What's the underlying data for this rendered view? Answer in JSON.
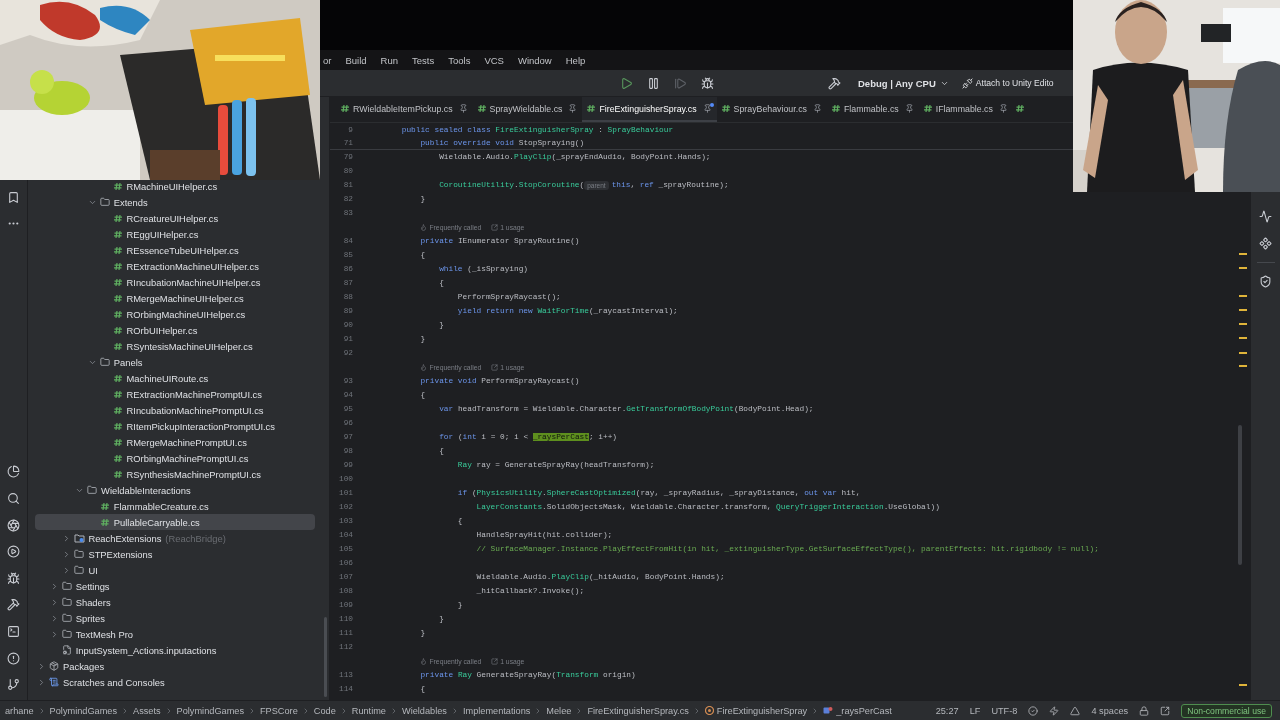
{
  "menu": [
    "or",
    "Build",
    "Run",
    "Tests",
    "Tools",
    "VCS",
    "Window",
    "Help"
  ],
  "toolbar": {
    "actions": [
      {
        "kind": "run",
        "disabled": false
      },
      {
        "kind": "pause",
        "disabled": false
      },
      {
        "kind": "step",
        "disabled": true
      },
      {
        "kind": "debug",
        "disabled": false
      }
    ],
    "configuration": "Debug | Any CPU",
    "attach": "Attach to Unity Edito"
  },
  "project_tree": [
    {
      "children": [
        {
          "children": [
            {
              "children": [
                {
                  "children": [
                    {
                      "children": [
                        {
                          "label": "RMachineUIHelper.cs",
                          "kind": "file",
                          "selected": false
                        }
                      ]
                    },
                    {
                      "label": "Extends",
                      "kind": "folder",
                      "expanded": true,
                      "selected": false,
                      "children": [
                        {
                          "label": "RCreatureUIHelper.cs",
                          "kind": "file",
                          "selected": false
                        },
                        {
                          "label": "REggUIHelper.cs",
                          "kind": "file",
                          "selected": false
                        },
                        {
                          "label": "REssenceTubeUIHelper.cs",
                          "kind": "file",
                          "selected": false
                        },
                        {
                          "label": "RExtractionMachineUIHelper.cs",
                          "kind": "file",
                          "selected": false
                        },
                        {
                          "label": "RIncubationMachineUIHelper.cs",
                          "kind": "file",
                          "selected": false
                        },
                        {
                          "label": "RMergeMachineUIHelper.cs",
                          "kind": "file",
                          "selected": false
                        },
                        {
                          "label": "ROrbingMachineUIHelper.cs",
                          "kind": "file",
                          "selected": false
                        },
                        {
                          "label": "ROrbUIHelper.cs",
                          "kind": "file",
                          "selected": false
                        },
                        {
                          "label": "RSyntesisMachineUIHelper.cs",
                          "kind": "file",
                          "selected": false
                        }
                      ]
                    },
                    {
                      "label": "Panels",
                      "kind": "folder",
                      "expanded": true,
                      "selected": false,
                      "children": [
                        {
                          "label": "MachineUIRoute.cs",
                          "kind": "file",
                          "selected": false
                        },
                        {
                          "label": "RExtractionMachinePromptUI.cs",
                          "kind": "file",
                          "selected": false
                        },
                        {
                          "label": "RIncubationMachinePromptUI.cs",
                          "kind": "file",
                          "selected": false
                        },
                        {
                          "label": "RItemPickupInteractionPromptUI.cs",
                          "kind": "file",
                          "selected": false
                        },
                        {
                          "label": "RMergeMachinePromptUI.cs",
                          "kind": "file",
                          "selected": false
                        },
                        {
                          "label": "ROrbingMachinePromptUI.cs",
                          "kind": "file",
                          "selected": false
                        },
                        {
                          "label": "RSynthesisMachinePromptUI.cs",
                          "kind": "file",
                          "selected": false
                        }
                      ]
                    }
                  ]
                },
                {
                  "label": "WieldableInteractions",
                  "kind": "folder",
                  "expanded": true,
                  "selected": false,
                  "children": [
                    {
                      "label": "FlammableCreature.cs",
                      "kind": "file",
                      "selected": false
                    },
                    {
                      "label": "PullableCarryable.cs",
                      "kind": "file",
                      "selected": true
                    }
                  ]
                }
              ]
            },
            {
              "label": "ReachExtensions",
              "note": "(ReachBridge)",
              "kind": "module",
              "expanded": false,
              "selected": false
            },
            {
              "label": "STPExtensions",
              "kind": "folder",
              "expanded": false,
              "selected": false
            },
            {
              "label": "UI",
              "kind": "folder",
              "expanded": false,
              "selected": false
            }
          ]
        },
        {
          "label": "Settings",
          "kind": "folder",
          "expanded": false,
          "selected": false
        },
        {
          "label": "Shaders",
          "kind": "folder",
          "expanded": false,
          "selected": false
        },
        {
          "label": "Sprites",
          "kind": "folder",
          "expanded": false,
          "selected": false
        },
        {
          "label": "TextMesh Pro",
          "kind": "folder",
          "expanded": false,
          "selected": false
        },
        {
          "label": "InputSystem_Actions.inputactions",
          "kind": "inputactions",
          "selected": false
        }
      ]
    },
    {
      "label": "Packages",
      "kind": "packages",
      "expanded": false,
      "selected": false
    },
    {
      "label": "Scratches and Consoles",
      "kind": "scratches",
      "expanded": false,
      "selected": false
    }
  ],
  "tabs": [
    {
      "label": "RWieldableItemPickup.cs",
      "selected": false,
      "modified": false
    },
    {
      "label": "SprayWieldable.cs",
      "selected": false,
      "modified": false
    },
    {
      "label": "FireExtinguisherSpray.cs",
      "selected": true,
      "modified": true
    },
    {
      "label": "SprayBehaviour.cs",
      "selected": false,
      "modified": false
    },
    {
      "label": "Flammable.cs",
      "selected": false,
      "modified": false
    },
    {
      "label": "IFlammable.cs",
      "selected": false,
      "modified": false
    }
  ],
  "sticky_lines": [
    {
      "number": "9",
      "tokens": [
        {
          "kind": "kw",
          "text": "    public sealed class "
        },
        {
          "kind": "type",
          "text": "FireExtinguisherSpray"
        },
        {
          "kind": "plain",
          "text": " : "
        },
        {
          "kind": "type",
          "text": "SprayBehaviour"
        }
      ]
    },
    {
      "number": "71",
      "tokens": [
        {
          "kind": "kw",
          "text": "        public override void "
        },
        {
          "kind": "plain",
          "text": "StopSpraying()"
        }
      ]
    }
  ],
  "code": [
    {
      "kind": "code",
      "number": "79",
      "tokens": [
        {
          "kind": "plain",
          "text": "            Wieldable.Audio."
        },
        {
          "kind": "type",
          "text": "PlayClip"
        },
        {
          "kind": "plain",
          "text": "(_sprayEndAudio, BodyPoint.Hands);"
        }
      ]
    },
    {
      "kind": "code",
      "number": "80"
    },
    {
      "kind": "code",
      "number": "81",
      "tokens": [
        {
          "kind": "type",
          "text": "            CoroutineUtility"
        },
        {
          "kind": "plain",
          "text": "."
        },
        {
          "kind": "type",
          "text": "StopCoroutine"
        },
        {
          "kind": "plain",
          "text": "("
        },
        {
          "kind": "hint",
          "text": "parent"
        },
        {
          "kind": "kw",
          "text": "this"
        },
        {
          "kind": "plain",
          "text": ", "
        },
        {
          "kind": "kw",
          "text": "ref"
        },
        {
          "kind": "plain",
          "text": " _sprayRoutine);"
        }
      ]
    },
    {
      "kind": "code",
      "number": "82",
      "tokens": [
        {
          "kind": "plain",
          "text": "        }"
        }
      ]
    },
    {
      "kind": "code",
      "number": "83"
    },
    {
      "kind": "hint",
      "hints": [
        "Frequently called",
        "1 usage"
      ]
    },
    {
      "kind": "code",
      "number": "84",
      "tokens": [
        {
          "kind": "kw",
          "text": "        private "
        },
        {
          "kind": "plain",
          "text": "IEnumerator SprayRoutine()"
        }
      ]
    },
    {
      "kind": "code",
      "number": "85",
      "tokens": [
        {
          "kind": "plain",
          "text": "        {"
        }
      ]
    },
    {
      "kind": "code",
      "number": "86",
      "tokens": [
        {
          "kind": "kw",
          "text": "            while"
        },
        {
          "kind": "plain",
          "text": " (_isSpraying)"
        }
      ]
    },
    {
      "kind": "code",
      "number": "87",
      "tokens": [
        {
          "kind": "plain",
          "text": "            {"
        }
      ]
    },
    {
      "kind": "code",
      "number": "88",
      "tokens": [
        {
          "kind": "plain",
          "text": "                PerformSprayRaycast();"
        }
      ]
    },
    {
      "kind": "code",
      "number": "89",
      "tokens": [
        {
          "kind": "kw",
          "text": "                yield return new "
        },
        {
          "kind": "type",
          "text": "WaitForTime"
        },
        {
          "kind": "plain",
          "text": "(_raycastInterval);"
        }
      ]
    },
    {
      "kind": "code",
      "number": "90",
      "tokens": [
        {
          "kind": "plain",
          "text": "            }"
        }
      ]
    },
    {
      "kind": "code",
      "number": "91",
      "tokens": [
        {
          "kind": "plain",
          "text": "        }"
        }
      ]
    },
    {
      "kind": "code",
      "number": "92"
    },
    {
      "kind": "hint",
      "hints": [
        "Frequently called",
        "1 usage"
      ]
    },
    {
      "kind": "code",
      "number": "93",
      "tokens": [
        {
          "kind": "kw",
          "text": "        private void "
        },
        {
          "kind": "plain",
          "text": "PerformSprayRaycast()"
        }
      ]
    },
    {
      "kind": "code",
      "number": "94",
      "tokens": [
        {
          "kind": "plain",
          "text": "        {"
        }
      ]
    },
    {
      "kind": "code",
      "number": "95",
      "tokens": [
        {
          "kind": "kw",
          "text": "            var "
        },
        {
          "kind": "plain",
          "text": "headTransform = Wieldable.Character."
        },
        {
          "kind": "type",
          "text": "GetTransformOfBodyPoint"
        },
        {
          "kind": "plain",
          "text": "(BodyPoint.Head);"
        }
      ]
    },
    {
      "kind": "code",
      "number": "96"
    },
    {
      "kind": "code",
      "number": "97",
      "tokens": [
        {
          "kind": "kw",
          "text": "            for "
        },
        {
          "kind": "plain",
          "text": "("
        },
        {
          "kind": "kw",
          "text": "int"
        },
        {
          "kind": "plain",
          "text": " i = 0; i < "
        },
        {
          "kind": "match",
          "text": "_raysPerCast"
        },
        {
          "kind": "plain",
          "text": "; i++)"
        }
      ]
    },
    {
      "kind": "code",
      "number": "98",
      "tokens": [
        {
          "kind": "plain",
          "text": "            {"
        }
      ]
    },
    {
      "kind": "code",
      "number": "99",
      "tokens": [
        {
          "kind": "type",
          "text": "                Ray"
        },
        {
          "kind": "plain",
          "text": " ray = GenerateSprayRay(headTransform);"
        }
      ]
    },
    {
      "kind": "code",
      "number": "100"
    },
    {
      "kind": "code",
      "number": "101",
      "tokens": [
        {
          "kind": "kw",
          "text": "                if"
        },
        {
          "kind": "plain",
          "text": " ("
        },
        {
          "kind": "type",
          "text": "PhysicsUtility"
        },
        {
          "kind": "plain",
          "text": "."
        },
        {
          "kind": "type",
          "text": "SphereCastOptimized"
        },
        {
          "kind": "plain",
          "text": "(ray, _sprayRadius, _sprayDistance, "
        },
        {
          "kind": "kw",
          "text": "out var"
        },
        {
          "kind": "plain",
          "text": " hit,"
        }
      ]
    },
    {
      "kind": "code",
      "number": "102",
      "tokens": [
        {
          "kind": "type",
          "text": "                    LayerConstants"
        },
        {
          "kind": "plain",
          "text": ".SolidObjectsMask, Wieldable.Character.transform, "
        },
        {
          "kind": "type",
          "text": "QueryTriggerInteraction"
        },
        {
          "kind": "plain",
          "text": ".UseGlobal))"
        }
      ]
    },
    {
      "kind": "code",
      "number": "103",
      "tokens": [
        {
          "kind": "plain",
          "text": "                {"
        }
      ]
    },
    {
      "kind": "code",
      "number": "104",
      "tokens": [
        {
          "kind": "plain",
          "text": "                    HandleSprayHit(hit.collider);"
        }
      ]
    },
    {
      "kind": "code",
      "number": "105",
      "tokens": [
        {
          "kind": "comment",
          "text": "                    // SurfaceManager.Instance.PlayEffectFromHit(in hit, _extinguisherType.GetSurfaceEffectType(), parentEffects: hit.rigidbody != null);"
        }
      ]
    },
    {
      "kind": "code",
      "number": "106"
    },
    {
      "kind": "code",
      "number": "107",
      "tokens": [
        {
          "kind": "plain",
          "text": "                    Wieldable.Audio."
        },
        {
          "kind": "type",
          "text": "PlayClip"
        },
        {
          "kind": "plain",
          "text": "(_hitAudio, BodyPoint.Hands);"
        }
      ]
    },
    {
      "kind": "code",
      "number": "108",
      "tokens": [
        {
          "kind": "plain",
          "text": "                    _hitCallback?.Invoke();"
        }
      ]
    },
    {
      "kind": "code",
      "number": "109",
      "tokens": [
        {
          "kind": "plain",
          "text": "                }"
        }
      ]
    },
    {
      "kind": "code",
      "number": "110",
      "tokens": [
        {
          "kind": "plain",
          "text": "            }"
        }
      ]
    },
    {
      "kind": "code",
      "number": "111",
      "tokens": [
        {
          "kind": "plain",
          "text": "        }"
        }
      ]
    },
    {
      "kind": "code",
      "number": "112"
    },
    {
      "kind": "hint",
      "hints": [
        "Frequently called",
        "1 usage"
      ]
    },
    {
      "kind": "code",
      "number": "113",
      "tokens": [
        {
          "kind": "kw",
          "text": "        private "
        },
        {
          "kind": "type",
          "text": "Ray"
        },
        {
          "kind": "plain",
          "text": " GenerateSprayRay("
        },
        {
          "kind": "type",
          "text": "Transform"
        },
        {
          "kind": "plain",
          "text": " origin)"
        }
      ]
    },
    {
      "kind": "code",
      "number": "114",
      "tokens": [
        {
          "kind": "plain",
          "text": "        {"
        }
      ]
    }
  ],
  "status_bar": {
    "breadcrumbs": [
      {
        "label": "arhane",
        "kind": "path"
      },
      {
        "label": "PolymindGames",
        "kind": "path"
      },
      {
        "label": "Assets",
        "kind": "path"
      },
      {
        "label": "PolymindGames",
        "kind": "path"
      },
      {
        "label": "FPSCore",
        "kind": "path"
      },
      {
        "label": "Code",
        "kind": "path"
      },
      {
        "label": "Runtime",
        "kind": "path"
      },
      {
        "label": "Wieldables",
        "kind": "path"
      },
      {
        "label": "Implementations",
        "kind": "path"
      },
      {
        "label": "Melee",
        "kind": "path"
      },
      {
        "label": "FireExtinguisherSpray.cs",
        "kind": "path"
      },
      {
        "label": "FireExtinguisherSpray",
        "kind": "class"
      },
      {
        "label": "_raysPerCast",
        "kind": "field"
      }
    ],
    "position": "25:27",
    "line_ending": "LF",
    "encoding": "UTF-8",
    "indent": "4 spaces",
    "license": "Non-commercial use"
  }
}
